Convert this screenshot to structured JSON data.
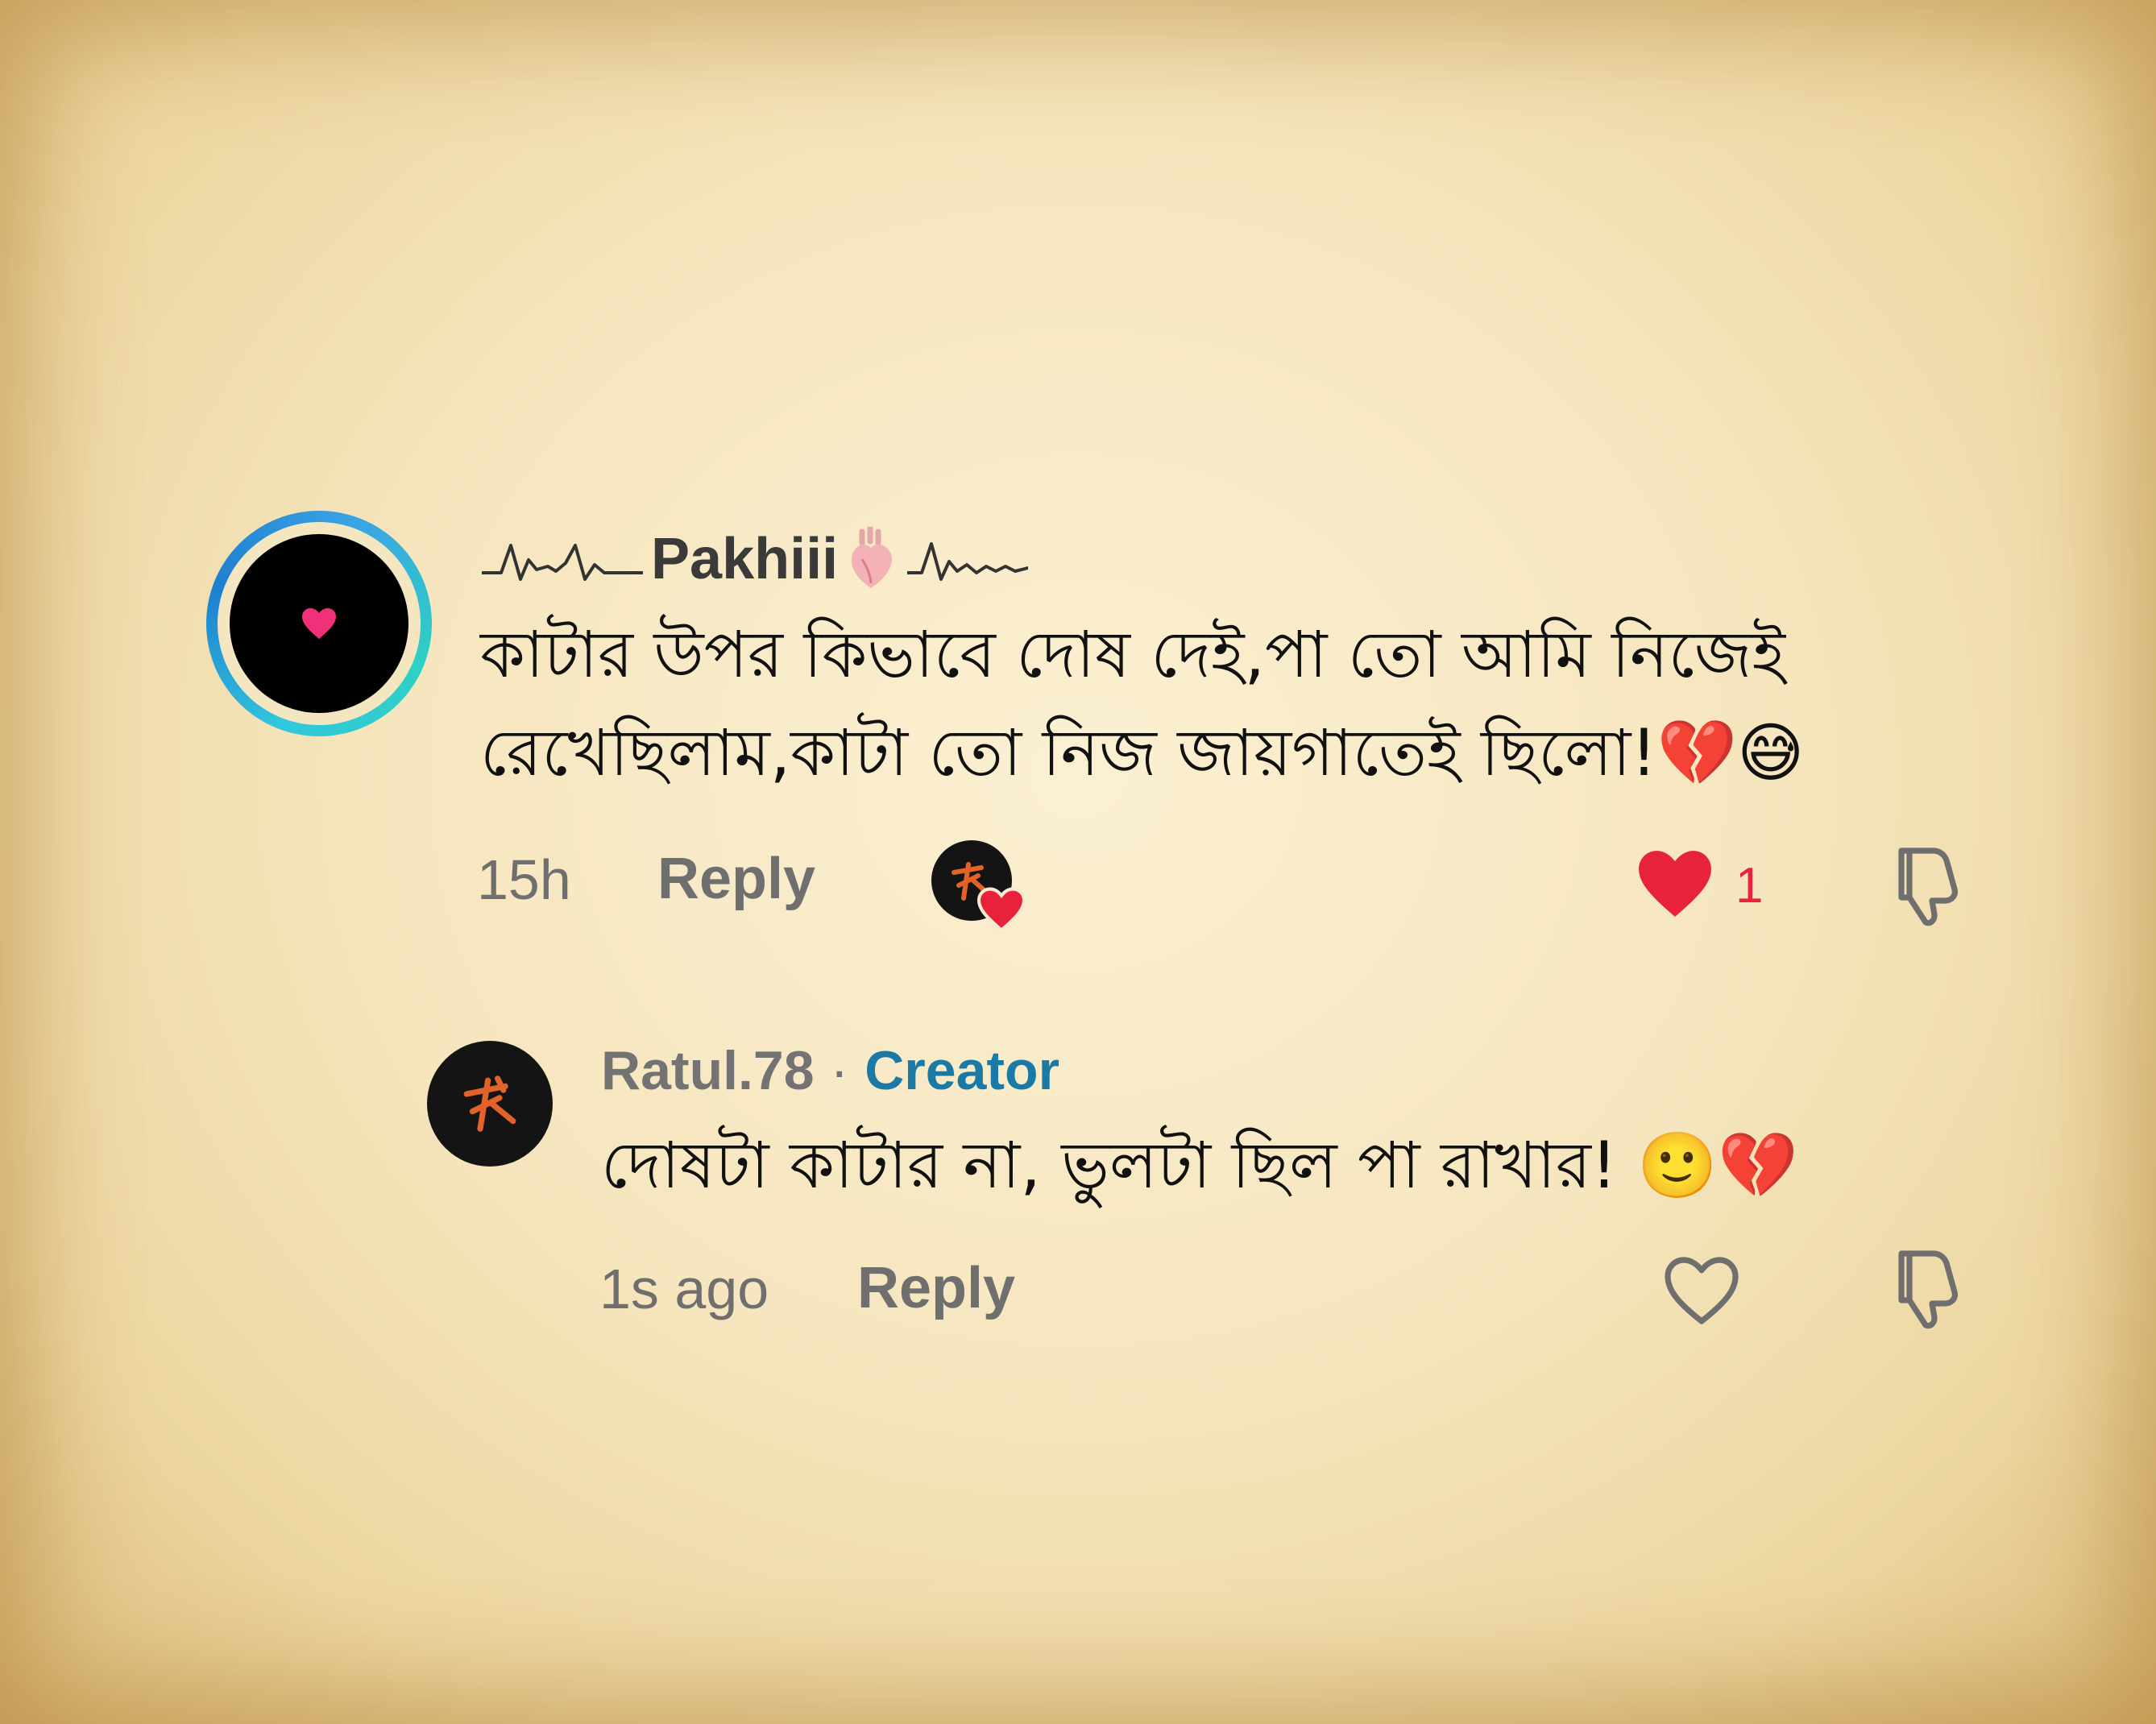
{
  "comment": {
    "username": "Pakhiii",
    "text_line1": "কাটার উপর কিভাবে দোষ দেই,পা তো আমি নিজেই",
    "text_line2": "রেখেছিলাম,কাটা তো নিজ জায়গাতেই ছিলো!💔😅",
    "time": "15h",
    "reply_label": "Reply",
    "like_count": "1",
    "liked": true
  },
  "reply": {
    "username": "Ratul.78",
    "separator": "·",
    "badge": "Creator",
    "text": "দোষটা কাটার না, ভুলটা ছিল পা রাখার! 🙂💔",
    "time": "1s ago",
    "reply_label": "Reply",
    "liked": false
  },
  "colors": {
    "like_red": "#e8223a",
    "creator_blue": "#1b7aa5",
    "muted_gray": "#6f6f6f",
    "ring_cyan": "#31c8dc",
    "ring_blue": "#1e7fd0"
  },
  "icons": {
    "heartbeat_left": "heartbeat-line-icon",
    "anatomical_heart": "anatomical-heart-icon",
    "heartbeat_right": "heartbeat-line-icon",
    "avatar_heart": "pink-heart-icon",
    "like": "heart-icon",
    "dislike": "thumbs-down-icon"
  }
}
